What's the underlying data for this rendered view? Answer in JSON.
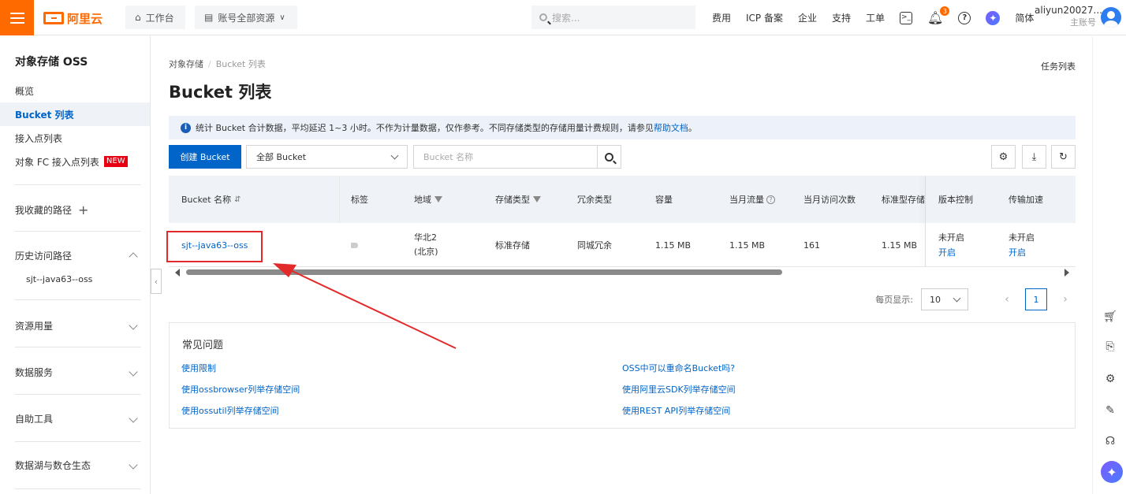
{
  "header": {
    "brand": "阿里云",
    "workbench": "工作台",
    "resources": "账号全部资源",
    "search_placeholder": "搜索...",
    "nav": [
      "费用",
      "ICP 备案",
      "企业",
      "支持",
      "工单"
    ],
    "notification_count": "3",
    "language": "简体",
    "account_name": "aliyun20027...",
    "account_role": "主账号"
  },
  "sidebar": {
    "title": "对象存储 OSS",
    "items": [
      {
        "label": "概览"
      },
      {
        "label": "Bucket 列表"
      },
      {
        "label": "接入点列表"
      },
      {
        "label": "对象 FC 接入点列表",
        "badge": "NEW"
      }
    ],
    "favorites": "我收藏的路径",
    "history": "历史访问路径",
    "history_items": [
      "sjt--java63--oss"
    ],
    "groups": [
      "资源用量",
      "数据服务",
      "自助工具",
      "数据湖与数仓生态"
    ]
  },
  "breadcrumb": {
    "root": "对象存储",
    "current": "Bucket 列表"
  },
  "task_list": "任务列表",
  "page_title": "Bucket 列表",
  "notice": {
    "text": "统计 Bucket 合计数据，平均延迟 1~3 小时。不作为计量数据，仅作参考。不同存储类型的存储用量计费规则，请参见",
    "link": "帮助文档",
    "end": "。"
  },
  "toolbar": {
    "create_label": "创建 Bucket",
    "filter_value": "全部 Bucket",
    "name_placeholder": "Bucket 名称"
  },
  "table": {
    "columns": [
      "Bucket 名称",
      "标签",
      "地域",
      "存储类型",
      "冗余类型",
      "容量",
      "当月流量",
      "当月访问次数",
      "标准型存储",
      "版本控制",
      "传输加速"
    ],
    "rows": [
      {
        "name": "sjt--java63--oss",
        "region_line1": "华北2",
        "region_line2": "(北京)",
        "storage_type": "标准存储",
        "redundancy": "同城冗余",
        "capacity": "1.15 MB",
        "traffic": "1.15 MB",
        "visits": "161",
        "standard_storage": "1.15 MB",
        "versioning": "未开启",
        "versioning_action": "开启",
        "acceleration": "未开启",
        "acceleration_action": "开启"
      }
    ]
  },
  "pagination": {
    "page_size_label": "每页显示:",
    "page_size": "10",
    "current_page": "1"
  },
  "faq": {
    "title": "常见问题",
    "links_left": [
      "使用限制",
      "使用ossbrowser列举存储空间",
      "使用ossutil列举存储空间"
    ],
    "links_right": [
      "OSS中可以重命名Bucket吗?",
      "使用阿里云SDK列举存储空间",
      "使用REST API列举存储空间"
    ]
  },
  "colors": {
    "brand": "#ff6a00",
    "primary": "#0064c8",
    "annotation_red": "#e32a2a"
  }
}
